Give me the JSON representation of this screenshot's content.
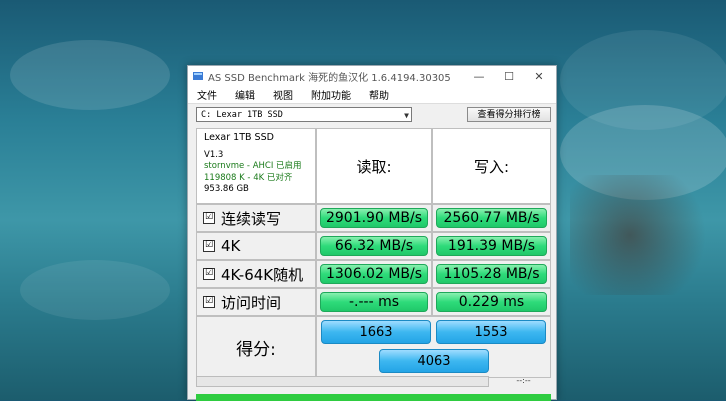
{
  "window": {
    "title": "AS SSD Benchmark 海死的鱼汉化 1.6.4194.30305",
    "controls": {
      "minimize": "—",
      "maximize": "☐",
      "close": "✕"
    }
  },
  "menu": [
    "文件",
    "编辑",
    "视图",
    "附加功能",
    "帮助"
  ],
  "toolbar": {
    "drive_select": "C: Lexar 1TB SSD",
    "rank_button": "查看得分排行榜"
  },
  "drive_info": {
    "model": "Lexar 1TB SSD",
    "version": "V1.3",
    "driver": "stornvme - AHCI 已启用",
    "alignment": "119808 K - 4K 已对齐",
    "size": "953.86 GB"
  },
  "headers": {
    "read": "读取:",
    "write": "写入:"
  },
  "rows": [
    {
      "label": "连续读写",
      "checked": "☑",
      "read": "2901.90 MB/s",
      "write": "2560.77 MB/s"
    },
    {
      "label": "4K",
      "checked": "☑",
      "read": "66.32 MB/s",
      "write": "191.39 MB/s"
    },
    {
      "label": "4K-64K随机",
      "checked": "☑",
      "read": "1306.02 MB/s",
      "write": "1105.28 MB/s"
    },
    {
      "label": "访问时间",
      "checked": "☑",
      "read": "-.--- ms",
      "write": "0.229 ms"
    }
  ],
  "score": {
    "label": "得分:",
    "read": "1663",
    "write": "1553",
    "total": "4063"
  },
  "progress": {
    "value": 0,
    "time": "--:--"
  },
  "colors": {
    "result_green": "#2edb7a",
    "score_blue": "#3db7f0",
    "progress_green": "#2ecc40"
  }
}
